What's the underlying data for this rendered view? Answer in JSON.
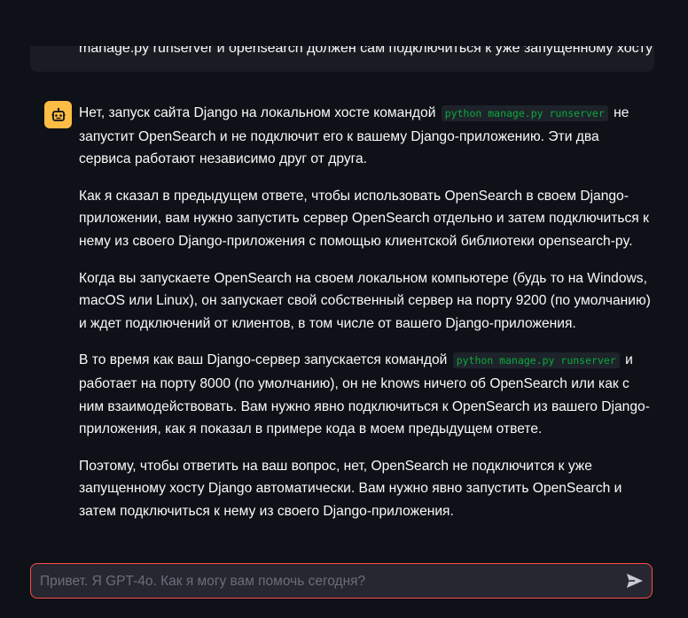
{
  "chat": {
    "previous_user_message": "manage.py runserver и opensearch должен сам подключиться к уже запущенному хосту?",
    "assistant": {
      "avatar_icon": "robot-icon",
      "paragraphs": [
        {
          "before": "Нет, запуск сайта Django на локальном хосте командой",
          "code": "python manage.py runserver",
          "after": "не запустит OpenSearch и не подключит его к вашему Django-приложению. Эти два сервиса работают независимо друг от друга."
        },
        {
          "text": "Как я сказал в предыдущем ответе, чтобы использовать OpenSearch в своем Django-приложении, вам нужно запустить сервер OpenSearch отдельно и затем подключиться к нему из своего Django-приложения с помощью клиентской библиотеки opensearch-py."
        },
        {
          "text": "Когда вы запускаете OpenSearch на своем локальном компьютере (будь то на Windows, macOS или Linux), он запускает свой собственный сервер на порту 9200 (по умолчанию) и ждет подключений от клиентов, в том числе от вашего Django-приложения."
        },
        {
          "before": "В то время как ваш Django-сервер запускается командой",
          "code": "python manage.py runserver",
          "after": "и работает на порту 8000 (по умолчанию), он не knows ничего об OpenSearch или как с ним взаимодействовать. Вам нужно явно подключиться к OpenSearch из вашего Django-приложения, как я показал в примере кода в моем предыдущем ответе."
        },
        {
          "text": "Поэтому, чтобы ответить на ваш вопрос, нет, OpenSearch не подключится к уже запущенному хосту Django автоматически. Вам нужно явно запустить OpenSearch и затем подключиться к нему из своего Django-приложения."
        }
      ]
    }
  },
  "input": {
    "placeholder": "Привет. Я GPT-4o. Как я могу вам помочь сегодня?",
    "value": "",
    "send_icon": "send-icon"
  },
  "colors": {
    "background": "#0e1117",
    "user_bubble": "#1a1c24",
    "avatar": "#ffbd45",
    "code_text": "#09ab3b",
    "input_border": "#ff4b4b",
    "input_bg": "#262730"
  }
}
